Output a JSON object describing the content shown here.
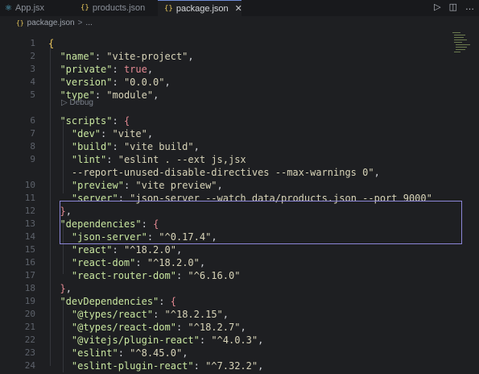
{
  "tabs": [
    {
      "label": "App.jsx",
      "icon": "react-icon",
      "active": false
    },
    {
      "label": "products.json",
      "icon": "json-braces-icon",
      "active": false
    },
    {
      "label": "package.json",
      "icon": "json-braces-icon",
      "active": true
    }
  ],
  "tab_close_glyph": "✕",
  "actions": {
    "run_glyph": "▷",
    "split_glyph": "◫",
    "more_glyph": "…"
  },
  "breadcrumb": {
    "icon_glyph": "{}",
    "file": "package.json",
    "sep": ">",
    "more": "..."
  },
  "codelens": {
    "label": "▷ Debug"
  },
  "lines": [
    {
      "n": "1",
      "segs": [
        {
          "c": "br",
          "t": "{"
        }
      ]
    },
    {
      "n": "2",
      "segs": [
        {
          "c": "p",
          "t": "  "
        },
        {
          "c": "k",
          "t": "\"name\""
        },
        {
          "c": "p",
          "t": ": "
        },
        {
          "c": "s",
          "t": "\"vite-project\""
        },
        {
          "c": "p",
          "t": ","
        }
      ]
    },
    {
      "n": "3",
      "segs": [
        {
          "c": "p",
          "t": "  "
        },
        {
          "c": "k",
          "t": "\"private\""
        },
        {
          "c": "p",
          "t": ": "
        },
        {
          "c": "b",
          "t": "true"
        },
        {
          "c": "p",
          "t": ","
        }
      ]
    },
    {
      "n": "4",
      "segs": [
        {
          "c": "p",
          "t": "  "
        },
        {
          "c": "k",
          "t": "\"version\""
        },
        {
          "c": "p",
          "t": ": "
        },
        {
          "c": "s",
          "t": "\"0.0.0\""
        },
        {
          "c": "p",
          "t": ","
        }
      ]
    },
    {
      "n": "5",
      "segs": [
        {
          "c": "p",
          "t": "  "
        },
        {
          "c": "k",
          "t": "\"type\""
        },
        {
          "c": "p",
          "t": ": "
        },
        {
          "c": "s",
          "t": "\"module\""
        },
        {
          "c": "p",
          "t": ","
        }
      ]
    },
    {
      "n": "6",
      "segs": [
        {
          "c": "p",
          "t": "  "
        },
        {
          "c": "k",
          "t": "\"scripts\""
        },
        {
          "c": "p",
          "t": ": "
        },
        {
          "c": "b",
          "t": "{"
        }
      ]
    },
    {
      "n": "7",
      "segs": [
        {
          "c": "p",
          "t": "    "
        },
        {
          "c": "k",
          "t": "\"dev\""
        },
        {
          "c": "p",
          "t": ": "
        },
        {
          "c": "s",
          "t": "\"vite\""
        },
        {
          "c": "p",
          "t": ","
        }
      ]
    },
    {
      "n": "8",
      "segs": [
        {
          "c": "p",
          "t": "    "
        },
        {
          "c": "k",
          "t": "\"build\""
        },
        {
          "c": "p",
          "t": ": "
        },
        {
          "c": "s",
          "t": "\"vite build\""
        },
        {
          "c": "p",
          "t": ","
        }
      ]
    },
    {
      "n": "9",
      "segs": [
        {
          "c": "p",
          "t": "    "
        },
        {
          "c": "k",
          "t": "\"lint\""
        },
        {
          "c": "p",
          "t": ": "
        },
        {
          "c": "s",
          "t": "\"eslint . --ext js,jsx"
        }
      ]
    },
    {
      "n": "",
      "segs": [
        {
          "c": "s",
          "t": "    --report-unused-disable-directives --max-warnings 0\""
        },
        {
          "c": "p",
          "t": ","
        }
      ]
    },
    {
      "n": "10",
      "segs": [
        {
          "c": "p",
          "t": "    "
        },
        {
          "c": "k",
          "t": "\"preview\""
        },
        {
          "c": "p",
          "t": ": "
        },
        {
          "c": "s",
          "t": "\"vite preview\""
        },
        {
          "c": "p",
          "t": ","
        }
      ]
    },
    {
      "n": "11",
      "segs": [
        {
          "c": "p",
          "t": "    "
        },
        {
          "c": "k",
          "t": "\"server\""
        },
        {
          "c": "p",
          "t": ": "
        },
        {
          "c": "s",
          "t": "\"json-server --watch data/products.json --port 9000\""
        }
      ]
    },
    {
      "n": "12",
      "segs": [
        {
          "c": "p",
          "t": "  "
        },
        {
          "c": "b",
          "t": "}"
        },
        {
          "c": "p",
          "t": ","
        }
      ]
    },
    {
      "n": "13",
      "segs": [
        {
          "c": "p",
          "t": "  "
        },
        {
          "c": "k",
          "t": "\"dependencies\""
        },
        {
          "c": "p",
          "t": ": "
        },
        {
          "c": "b",
          "t": "{"
        }
      ]
    },
    {
      "n": "14",
      "segs": [
        {
          "c": "p",
          "t": "    "
        },
        {
          "c": "k",
          "t": "\"json-server\""
        },
        {
          "c": "p",
          "t": ": "
        },
        {
          "c": "s",
          "t": "\"^0.17.4\""
        },
        {
          "c": "p",
          "t": ","
        }
      ]
    },
    {
      "n": "15",
      "segs": [
        {
          "c": "p",
          "t": "    "
        },
        {
          "c": "k",
          "t": "\"react\""
        },
        {
          "c": "p",
          "t": ": "
        },
        {
          "c": "s",
          "t": "\"^18.2.0\""
        },
        {
          "c": "p",
          "t": ","
        }
      ]
    },
    {
      "n": "16",
      "segs": [
        {
          "c": "p",
          "t": "    "
        },
        {
          "c": "k",
          "t": "\"react-dom\""
        },
        {
          "c": "p",
          "t": ": "
        },
        {
          "c": "s",
          "t": "\"^18.2.0\""
        },
        {
          "c": "p",
          "t": ","
        }
      ]
    },
    {
      "n": "17",
      "segs": [
        {
          "c": "p",
          "t": "    "
        },
        {
          "c": "k",
          "t": "\"react-router-dom\""
        },
        {
          "c": "p",
          "t": ": "
        },
        {
          "c": "s",
          "t": "\"^6.16.0\""
        }
      ]
    },
    {
      "n": "18",
      "segs": [
        {
          "c": "p",
          "t": "  "
        },
        {
          "c": "b",
          "t": "}"
        },
        {
          "c": "p",
          "t": ","
        }
      ]
    },
    {
      "n": "19",
      "segs": [
        {
          "c": "p",
          "t": "  "
        },
        {
          "c": "k",
          "t": "\"devDependencies\""
        },
        {
          "c": "p",
          "t": ": "
        },
        {
          "c": "b",
          "t": "{"
        }
      ]
    },
    {
      "n": "20",
      "segs": [
        {
          "c": "p",
          "t": "    "
        },
        {
          "c": "k",
          "t": "\"@types/react\""
        },
        {
          "c": "p",
          "t": ": "
        },
        {
          "c": "s",
          "t": "\"^18.2.15\""
        },
        {
          "c": "p",
          "t": ","
        }
      ]
    },
    {
      "n": "21",
      "segs": [
        {
          "c": "p",
          "t": "    "
        },
        {
          "c": "k",
          "t": "\"@types/react-dom\""
        },
        {
          "c": "p",
          "t": ": "
        },
        {
          "c": "s",
          "t": "\"^18.2.7\""
        },
        {
          "c": "p",
          "t": ","
        }
      ]
    },
    {
      "n": "22",
      "segs": [
        {
          "c": "p",
          "t": "    "
        },
        {
          "c": "k",
          "t": "\"@vitejs/plugin-react\""
        },
        {
          "c": "p",
          "t": ": "
        },
        {
          "c": "s",
          "t": "\"^4.0.3\""
        },
        {
          "c": "p",
          "t": ","
        }
      ]
    },
    {
      "n": "23",
      "segs": [
        {
          "c": "p",
          "t": "    "
        },
        {
          "c": "k",
          "t": "\"eslint\""
        },
        {
          "c": "p",
          "t": ": "
        },
        {
          "c": "s",
          "t": "\"^8.45.0\""
        },
        {
          "c": "p",
          "t": ","
        }
      ]
    },
    {
      "n": "24",
      "segs": [
        {
          "c": "p",
          "t": "    "
        },
        {
          "c": "k",
          "t": "\"eslint-plugin-react\""
        },
        {
          "c": "p",
          "t": ": "
        },
        {
          "c": "s",
          "t": "\"^7.32.2\""
        },
        {
          "c": "p",
          "t": ","
        }
      ]
    }
  ]
}
